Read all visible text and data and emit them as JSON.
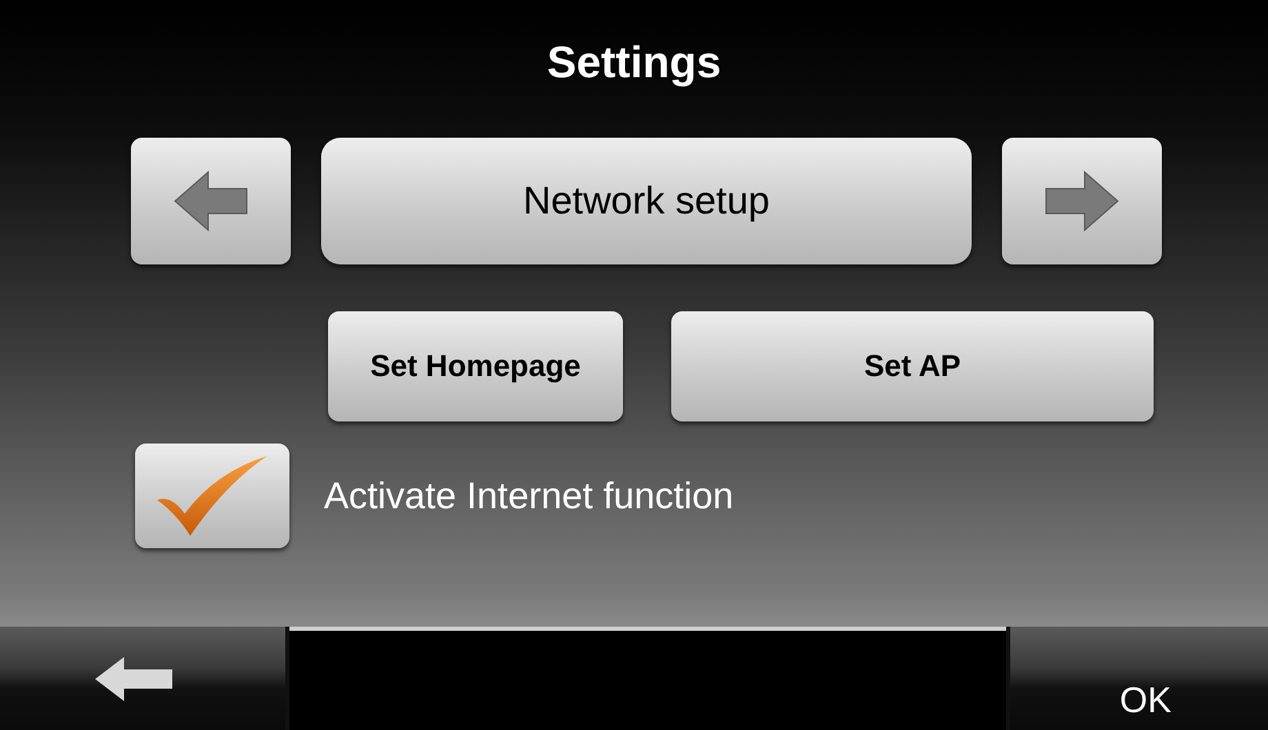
{
  "title": "Settings",
  "page_selector": {
    "label": "Network setup"
  },
  "buttons": [
    {
      "label": "Set Homepage"
    },
    {
      "label": "Set AP"
    }
  ],
  "option": {
    "label": "Activate Internet function",
    "checked": true
  },
  "bottom_bar": {
    "ok_label": "OK"
  }
}
